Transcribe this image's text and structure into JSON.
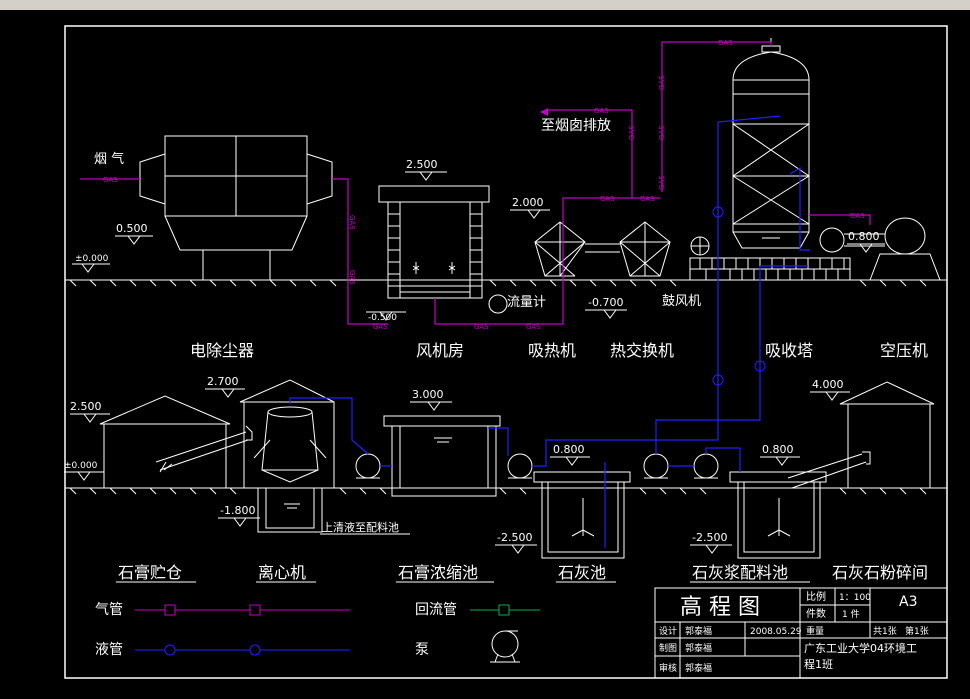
{
  "labels": {
    "smoke": "烟  气",
    "chimney": "至烟囱排放",
    "flowmeter": "流量计",
    "blower": "鼓风机"
  },
  "pipe_tag": "GAS",
  "elevations": {
    "e_0_500": "0.500",
    "e_000_top": "±0.000",
    "e_2_500_fan": "2.500",
    "e_2_000": "2.000",
    "e_m0_500": "-0.500",
    "e_m0_700": "-0.700",
    "e_0_800_air": "0.800",
    "e_2_700": "2.700",
    "e_2_500_bin": "2.500",
    "e_000_bot": "±0.000",
    "e_3_000": "3.000",
    "e_m1_800": "-1.800",
    "e_0_800_a": "0.800",
    "e_0_800_b": "0.800",
    "e_4_000": "4.000",
    "e_m2_500_a": "-2.500",
    "e_m2_500_b": "-2.500"
  },
  "upper_equipment": [
    "电除尘器",
    "风机房",
    "吸热机",
    "热交换机",
    "吸收塔",
    "空压机"
  ],
  "lower_equipment": [
    "石膏贮仓",
    "离心机",
    "石膏浓缩池",
    "石灰池",
    "石灰浆配料池",
    "石灰石粉碎间"
  ],
  "supernatant_note": "上清液至配料池",
  "legend": {
    "gas_pipe": "气管",
    "return_pipe": "回流管",
    "liquid_pipe": "液管",
    "pump": "泵"
  },
  "title_block": {
    "title": "高 程 图",
    "scale_label": "比例",
    "scale_value": "1：100",
    "sheet_size": "A3",
    "qty_label": "件数",
    "qty_value": "1 件",
    "design_label": "设计",
    "design_name": "郭泰福",
    "date": "2008.05.29",
    "weight_label": "重量",
    "sheet_count": "共1张",
    "sheet_no": "第1张",
    "drawn_label": "制图",
    "drawn_name": "郭泰福",
    "institution": "广东工业大学04环境工",
    "institution_line2": "程1班",
    "review_label": "审核",
    "review_name": "郭泰福"
  },
  "colors": {
    "gas": "#c400c4",
    "liquid": "#2020ff",
    "return": "#00b050",
    "lines": "#ffffff"
  }
}
